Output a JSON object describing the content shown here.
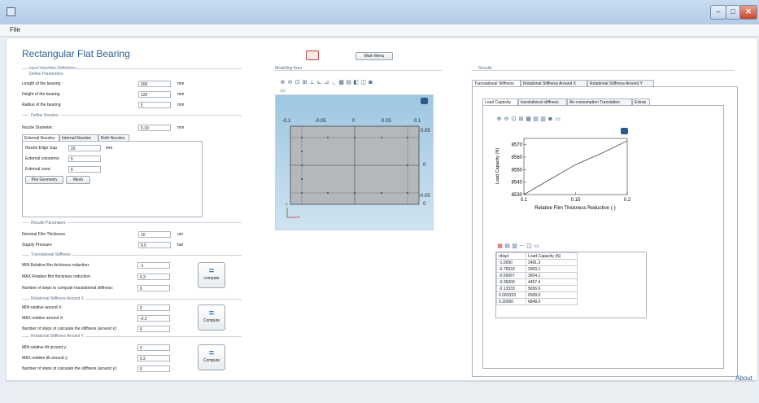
{
  "window": {
    "title": "",
    "min": "–",
    "max": "□",
    "close": "✕"
  },
  "menu": {
    "file": "File"
  },
  "app_title": "Rectangular Flat Bearing",
  "input": {
    "group": "Input Variables Definitions",
    "subgroup": "Define Parameters",
    "rows": [
      {
        "label": "Length of the bearing",
        "value": "200",
        "unit": "mm"
      },
      {
        "label": "Height of the bearing",
        "value": "120",
        "unit": "mm"
      },
      {
        "label": "Radius of the bearing",
        "value": "5",
        "unit": "mm"
      }
    ],
    "nozzles_group": "Define Nozzles",
    "nozzle_diameter": {
      "label": "Nozzle Diameter:",
      "value": "0.19",
      "unit": "mm"
    },
    "tabs": [
      "External Nozzles",
      "Internal Nozzles",
      "Both Nozzles"
    ],
    "edge_gap": {
      "label": "Nozzle Edge Gap",
      "value": "20",
      "unit": "mm"
    },
    "ext_columns": {
      "label": "External colounms:",
      "value": "5"
    },
    "ext_rows": {
      "label": "External rows:",
      "value": "6"
    },
    "plot_button": "Plot Geometry",
    "mesh_button": "Mesh"
  },
  "results_params": {
    "group": "Results Paramaers",
    "film": {
      "label": "Nominal Film Thickness",
      "value": "10",
      "unit": "um"
    },
    "pressure": {
      "label": "Supply Pressure",
      "value": "6.5",
      "unit": "bar"
    }
  },
  "trans": {
    "group": "Translational Stiffness",
    "min": {
      "label": "MIN Relative film thickness reduction:",
      "value": "-1"
    },
    "max": {
      "label": "MAX Relative film thickness reduction:",
      "value": "0.3"
    },
    "steps": {
      "label": "Number of steps to compute translational stiffness:",
      "value": "6"
    },
    "button": "compute"
  },
  "rotx": {
    "group": "Rotational Stiffness Around X",
    "min": {
      "label": "MIN relative around X:",
      "value": "0"
    },
    "max": {
      "label": "MAX relative around X:",
      "value": "-0.2"
    },
    "steps": {
      "label": "Number of steps ot calculate the stiffness (around x):",
      "value": "6"
    },
    "button": "Compute"
  },
  "roty": {
    "group": "Rotational Stiffness Around Y",
    "min": {
      "label": "MIN relative tilt around y:",
      "value": "0"
    },
    "max": {
      "label": "MAX relative tilt around y:",
      "value": "0.2"
    },
    "steps": {
      "label": "Number of steps ot calculate the stiffness (around y):",
      "value": "6"
    },
    "button": "Compute"
  },
  "main_menu": "Main Menu",
  "modeling": {
    "label": "Modelling Area",
    "xticks": [
      "-0.1",
      "-0.05",
      "0",
      "0.05",
      "0.1"
    ],
    "yticks": [
      "0.05",
      "0",
      "-0.05",
      "0"
    ],
    "axis_y": "y",
    "axis_x": "x"
  },
  "results": {
    "label": "Results",
    "tabs": [
      "Translational Stiffness",
      "Rotational Stiffness Around X",
      "Rotational Stiffness Around Y"
    ],
    "subtabs": [
      "Load Capacity",
      "translational stiffness",
      "Air consumption Translation",
      "Extras"
    ]
  },
  "chart_data": {
    "type": "line",
    "xlabel": "Relative Film Thickness Reduction (-)",
    "ylabel": "Load Capacity (N)",
    "xlim": [
      0.1,
      0.2
    ],
    "ylim": [
      8530,
      8575
    ],
    "xticks": [
      "0.1",
      "0.15",
      "0.2"
    ],
    "yticks": [
      "8530",
      "8540",
      "8550",
      "8560",
      "8570"
    ],
    "x": [
      0.1,
      0.125,
      0.15,
      0.175,
      0.2
    ],
    "y": [
      8530,
      8542,
      8554,
      8563,
      8573
    ]
  },
  "table": {
    "headers": [
      "rdispl",
      "Load Capacity (N)"
    ],
    "rows": [
      [
        "-1.0000",
        "2481.3"
      ],
      [
        "-0.78333",
        "2909.1"
      ],
      [
        "-0.56667",
        "3604.1"
      ],
      [
        "-0.35000",
        "4457.4"
      ],
      [
        "-0.13333",
        "5656.6"
      ],
      [
        "0.083333",
        "6508.0"
      ],
      [
        "0.30000",
        "6848.0"
      ]
    ]
  },
  "about": "About",
  "colors": {
    "accent": "#3a78b8",
    "plot_bg": "#b5d3e8",
    "title": "#2e5f93"
  }
}
